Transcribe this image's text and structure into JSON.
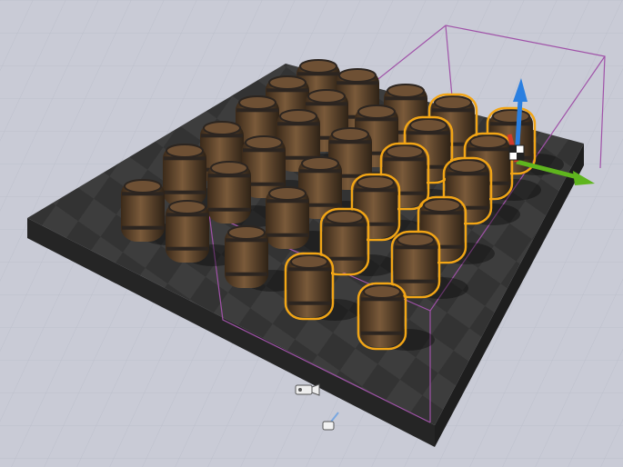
{
  "viewport": {
    "background_color": "#c9cbd6",
    "grid_line_color": "#bcbfcb",
    "platform_top_color": "#3a3a3a",
    "platform_side_color": "#262626",
    "selection_outline_color": "#f2a516",
    "bounds_box_color": "#a052a8"
  },
  "barrels": {
    "total": 30,
    "selected": 12,
    "wood_color": "#5b4128",
    "band_color": "#2c2520"
  },
  "gizmo": {
    "x_axis_color": "#5fb51e",
    "y_axis_color": "#d23b2a",
    "z_axis_color": "#2a7fe0",
    "icon": "transform-gizmo-icon"
  },
  "icons": {
    "camera": "camera-actor-icon",
    "light": "light-actor-icon"
  }
}
